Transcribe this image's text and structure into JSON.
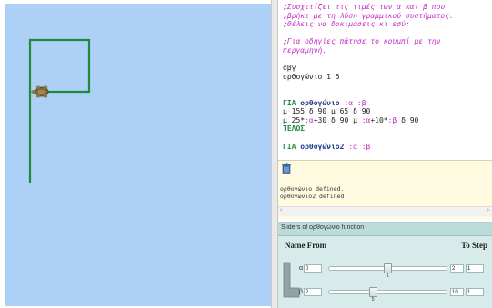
{
  "editor": {
    "lines": [
      {
        "segments": [
          {
            "text": ";Συσχετίζει τις τιμές των α και β που",
            "cls": "c"
          }
        ]
      },
      {
        "segments": [
          {
            "text": ";βρήκε με τη λύση γραμμικού συστήματος.",
            "cls": "c"
          }
        ]
      },
      {
        "segments": [
          {
            "text": ";Θέλεις να δοκιμάσεις κι εσύ;",
            "cls": "c"
          }
        ]
      },
      {
        "segments": [
          {
            "text": "",
            "cls": "t"
          }
        ]
      },
      {
        "segments": [
          {
            "text": ";Για οδηγίες πάτησε το κουμπί με την",
            "cls": "c"
          }
        ]
      },
      {
        "segments": [
          {
            "text": "περγαμηνή.",
            "cls": "c"
          }
        ]
      },
      {
        "segments": [
          {
            "text": "",
            "cls": "t"
          }
        ]
      },
      {
        "segments": [
          {
            "text": "σβγ",
            "cls": "t"
          }
        ]
      },
      {
        "segments": [
          {
            "text": "ορθογώνιο 1 5",
            "cls": "t"
          }
        ]
      },
      {
        "segments": [
          {
            "text": "",
            "cls": "t"
          }
        ]
      },
      {
        "segments": [
          {
            "text": "",
            "cls": "t"
          }
        ]
      },
      {
        "segments": [
          {
            "text": "ΓΙΑ ",
            "cls": "k"
          },
          {
            "text": "ορθογώνιο",
            "cls": "n k"
          },
          {
            "text": " :α :β",
            "cls": "v"
          }
        ]
      },
      {
        "segments": [
          {
            "text": "μ 155 δ 90 μ 65 δ 90",
            "cls": "t"
          }
        ]
      },
      {
        "segments": [
          {
            "text": "μ 25*",
            "cls": "t"
          },
          {
            "text": ":α",
            "cls": "v"
          },
          {
            "text": "+30 δ 90 μ ",
            "cls": "t"
          },
          {
            "text": ":α",
            "cls": "v"
          },
          {
            "text": "+10*",
            "cls": "t"
          },
          {
            "text": ":β",
            "cls": "v"
          },
          {
            "text": " δ 90",
            "cls": "t"
          }
        ]
      },
      {
        "segments": [
          {
            "text": "ΤΕΛΟΣ",
            "cls": "k"
          }
        ]
      },
      {
        "segments": [
          {
            "text": "",
            "cls": "t"
          }
        ]
      },
      {
        "segments": [
          {
            "text": "ΓΙΑ ",
            "cls": "k"
          },
          {
            "text": "ορθογώνιο2",
            "cls": "n k"
          },
          {
            "text": " :α :β",
            "cls": "v"
          }
        ]
      }
    ]
  },
  "output": {
    "lines": [
      "ορθογώνιο defined.",
      "ορθογώνιο2 defined."
    ],
    "trash_icon": "trash-icon"
  },
  "sliders_panel": {
    "title": "Sliders of ορθογώνιο function",
    "header_name_from": "Name From",
    "header_to_step": "To Step",
    "rows": [
      {
        "name": "α",
        "from": "0",
        "value": "1",
        "to": "2",
        "step": "1",
        "fraction": 0.5
      },
      {
        "name": "β",
        "from": "2",
        "value": "5",
        "to": "10",
        "step": "1",
        "fraction": 0.375
      }
    ]
  },
  "colors": {
    "canvas_bg": "#acd0f6",
    "turtle_path": "#1e8a3a",
    "comment": "#c332c3",
    "keyword": "#2a8a4c",
    "procedure_name": "#1d3b8b",
    "output_bg": "#fffbe0",
    "sliders_bg": "#d6ebea"
  }
}
